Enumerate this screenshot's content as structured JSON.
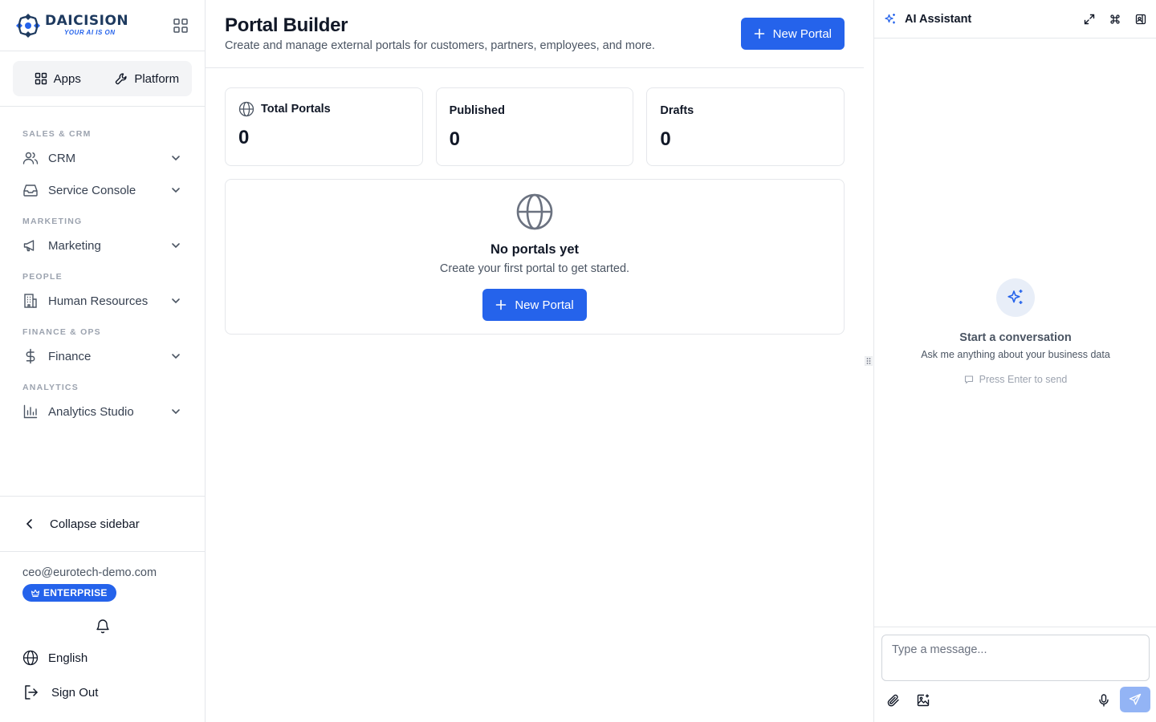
{
  "brand": {
    "name": "DAICISION",
    "tagline": "YOUR AI IS ON",
    "colors": {
      "primary": "#2563eb",
      "navy": "#1e3a5f",
      "send_disabled": "#93b4f5"
    }
  },
  "sidebar": {
    "switcher": [
      {
        "label": "Apps",
        "icon": "grid-icon"
      },
      {
        "label": "Platform",
        "icon": "wrench-icon"
      }
    ],
    "sections": [
      {
        "title": "SALES & CRM",
        "items": [
          {
            "label": "CRM",
            "icon": "users-icon"
          },
          {
            "label": "Service Console",
            "icon": "inbox-icon"
          }
        ]
      },
      {
        "title": "MARKETING",
        "items": [
          {
            "label": "Marketing",
            "icon": "megaphone-icon"
          }
        ]
      },
      {
        "title": "PEOPLE",
        "items": [
          {
            "label": "Human Resources",
            "icon": "building-icon"
          }
        ]
      },
      {
        "title": "FINANCE & OPS",
        "items": [
          {
            "label": "Finance",
            "icon": "dollar-icon"
          }
        ]
      },
      {
        "title": "ANALYTICS",
        "items": [
          {
            "label": "Analytics Studio",
            "icon": "bar-chart-icon"
          }
        ]
      }
    ],
    "collapse_label": "Collapse sidebar",
    "user": {
      "email": "ceo@eurotech-demo.com",
      "plan": "ENTERPRISE"
    },
    "language": "English",
    "sign_out": "Sign Out"
  },
  "main": {
    "title": "Portal Builder",
    "subtitle": "Create and manage external portals for customers, partners, employees, and more.",
    "new_portal_label": "New Portal",
    "stats": [
      {
        "label": "Total Portals",
        "value": "0",
        "icon": "globe-icon"
      },
      {
        "label": "Published",
        "value": "0"
      },
      {
        "label": "Drafts",
        "value": "0"
      }
    ],
    "empty": {
      "title": "No portals yet",
      "subtitle": "Create your first portal to get started.",
      "button_label": "New Portal"
    }
  },
  "ai_panel": {
    "title": "AI Assistant",
    "empty_title": "Start a conversation",
    "empty_subtitle": "Ask me anything about your business data",
    "hint": "Press Enter to send",
    "input_placeholder": "Type a message..."
  }
}
